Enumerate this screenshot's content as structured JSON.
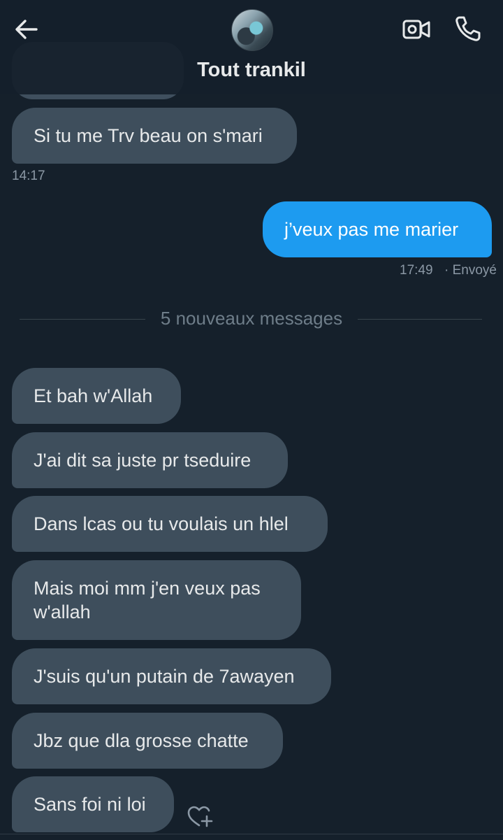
{
  "header": {
    "title": "Tout trankil",
    "back_icon": "arrow-left-icon",
    "video_icon": "video-camera-icon",
    "phone_icon": "phone-icon"
  },
  "messages": [
    {
      "from": "them",
      "text": "Si tu me Trv beau on s'mari",
      "time": "14:17"
    },
    {
      "from": "me",
      "text": "j’veux pas me marier",
      "time": "17:49",
      "status": "· Envoyé"
    },
    {
      "from": "them",
      "text": "Et bah w'Allah"
    },
    {
      "from": "them",
      "text": "J'ai dit sa juste pr tseduire"
    },
    {
      "from": "them",
      "text": "Dans lcas ou tu voulais un hlel"
    },
    {
      "from": "them",
      "text": "Mais moi mm j'en veux pas w'allah"
    },
    {
      "from": "them",
      "text": "J'suis qu'un putain de 7awayen"
    },
    {
      "from": "them",
      "text": "Jbz que dla grosse chatte"
    },
    {
      "from": "them",
      "text": "Sans foi ni loi"
    }
  ],
  "divider": {
    "text": "5 nouveaux messages"
  },
  "colors": {
    "background": "#15202b",
    "received_bubble": "#3e4e5c",
    "sent_bubble": "#1d9bf0",
    "muted": "#8b98a5"
  },
  "reaction_icon": "heart-plus-icon"
}
